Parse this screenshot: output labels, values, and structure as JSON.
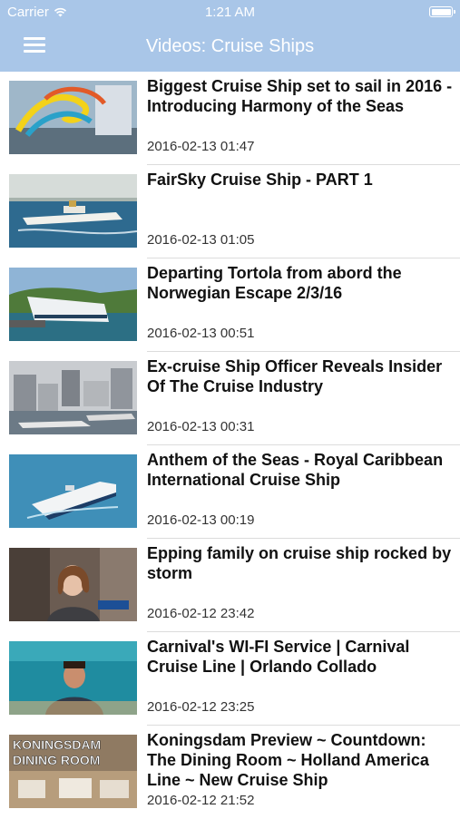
{
  "status": {
    "carrier": "Carrier",
    "time": "1:21 AM"
  },
  "nav": {
    "title": "Videos: Cruise Ships",
    "menu_icon": "hamburger-menu-icon"
  },
  "colors": {
    "header": "#a9c6e8",
    "text": "#111111"
  },
  "videos": [
    {
      "title": "Biggest Cruise Ship set to sail in 2016 - Introducing Harmony of the Seas",
      "date": "2016-02-13 01:47"
    },
    {
      "title": "FairSky Cruise Ship - PART 1",
      "date": "2016-02-13 01:05"
    },
    {
      "title": "Departing Tortola from abord the Norwegian Escape 2/3/16",
      "date": "2016-02-13 00:51"
    },
    {
      "title": "Ex-cruise Ship Officer Reveals Insider Of The Cruise Industry",
      "date": "2016-02-13 00:31"
    },
    {
      "title": "Anthem of the Seas - Royal Caribbean International Cruise Ship",
      "date": "2016-02-13 00:19"
    },
    {
      "title": "Epping family on cruise ship rocked by storm",
      "date": "2016-02-12 23:42"
    },
    {
      "title": "Carnival's WI-FI Service | Carnival Cruise Line | Orlando Collado",
      "date": "2016-02-12 23:25"
    },
    {
      "title": "Koningsdam Preview ~ Countdown: The Dining Room ~ Holland America Line ~ New Cruise Ship",
      "date": "2016-02-12 21:52",
      "thumb_text": [
        "KONINGSDAM",
        "DINING ROOM"
      ]
    }
  ]
}
